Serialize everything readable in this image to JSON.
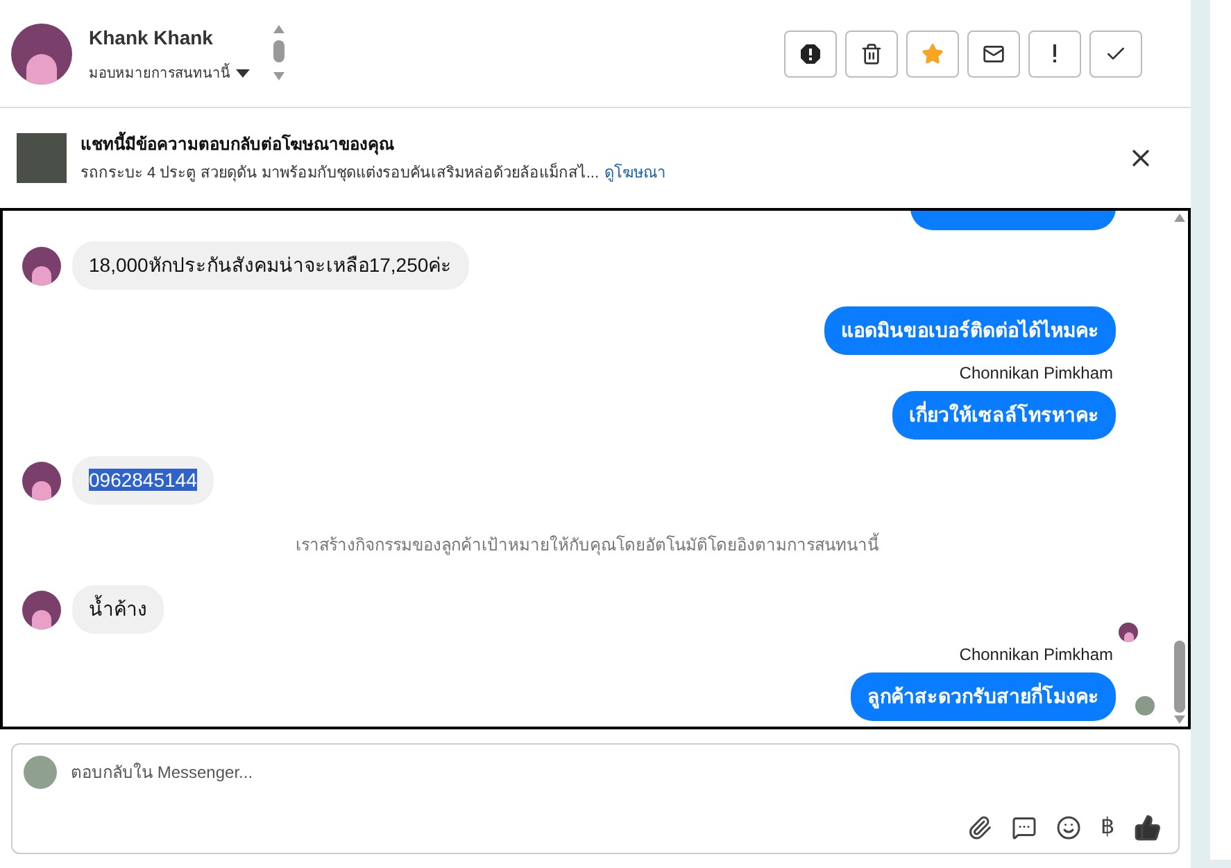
{
  "header": {
    "name": "Khank Khank",
    "assign_label": "มอบหมายการสนทนานี้"
  },
  "toolbar": [
    {
      "kind": "spam"
    },
    {
      "kind": "delete"
    },
    {
      "kind": "star",
      "selected": true
    },
    {
      "kind": "unread"
    },
    {
      "kind": "important"
    },
    {
      "kind": "done"
    }
  ],
  "ad_banner": {
    "title": "แชทนี้มีข้อความตอบกลับต่อโฆษณาของคุณ",
    "description": "รถกระบะ 4 ประตู สวยดุดัน มาพร้อมกับชุดแต่งรอบคันเสริมหล่อด้วยล้อแม็กสไ...",
    "link": "ดูโฆษณา"
  },
  "messages": [
    {
      "kind": "clipped_outgoing"
    },
    {
      "kind": "incoming",
      "text": "18,000หักประกันสังคมน่าจะเหลือ17,250ค่ะ",
      "highlighted": false
    },
    {
      "kind": "outgoing",
      "text": "แอดมินขอเบอร์ติดต่อได้ไหมคะ"
    },
    {
      "kind": "sender",
      "text": "Chonnikan Pimkham"
    },
    {
      "kind": "outgoing",
      "text": "เกี่ยวให้เซลล์โทรหาคะ"
    },
    {
      "kind": "incoming",
      "text": "0962845144",
      "highlighted": true
    },
    {
      "kind": "system",
      "text": "เราสร้างกิจกรรมของลูกค้าเป้าหมายให้กับคุณโดยอัตโนมัติโดยอิงตามการสนทนานี้"
    },
    {
      "kind": "incoming",
      "text": "น้ำค้าง",
      "highlighted": false
    },
    {
      "kind": "seen"
    },
    {
      "kind": "sender",
      "text": "Chonnikan Pimkham"
    },
    {
      "kind": "outgoing",
      "text": "ลูกค้าสะดวกรับสายกี่โมงคะ",
      "seen_avatar": true
    }
  ],
  "composer": {
    "placeholder": "ตอบกลับใน Messenger...",
    "currency_symbol": "฿"
  }
}
